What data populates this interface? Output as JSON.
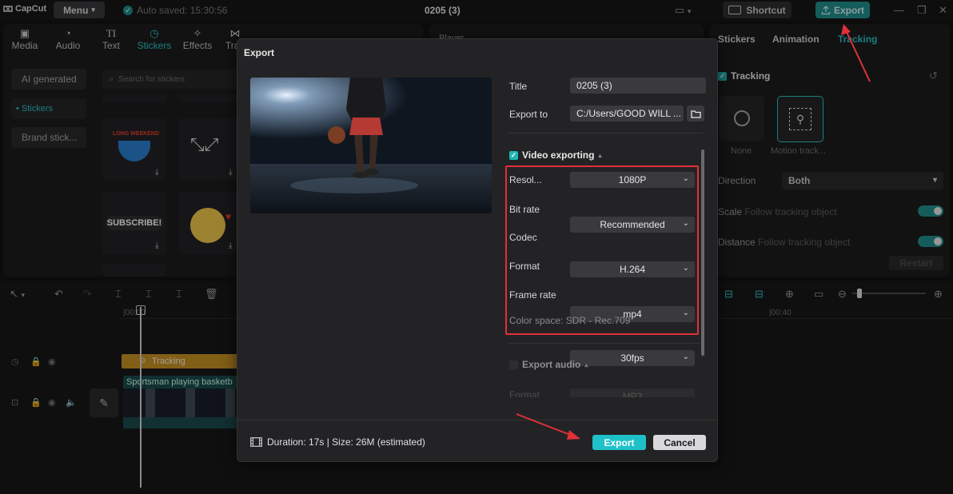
{
  "app": {
    "logo": "CapCut",
    "menu_label": "Menu",
    "autosave": "Auto saved: 15:30:56",
    "project_title": "0205 (3)",
    "shortcut_label": "Shortcut",
    "export_label": "Export"
  },
  "tools": [
    {
      "label": "Media",
      "icon": "media-icon"
    },
    {
      "label": "Audio",
      "icon": "audio-icon"
    },
    {
      "label": "Text",
      "icon": "text-icon"
    },
    {
      "label": "Stickers",
      "icon": "stickers-icon"
    },
    {
      "label": "Effects",
      "icon": "effects-icon"
    },
    {
      "label": "Tran",
      "icon": "transitions-icon"
    }
  ],
  "left_sidebar": {
    "items": [
      "AI generated",
      "• Stickers",
      "Brand stick..."
    ],
    "search_placeholder": "Search for stickers"
  },
  "stickers": {
    "subscribe_text": "SUBSCRIBE!",
    "long_weekend_text": "LONG WEEKEND"
  },
  "player": {
    "label": "Player"
  },
  "right_panel": {
    "tabs": [
      "Stickers",
      "Animation",
      "Tracking"
    ],
    "tracking_header": "Tracking",
    "options": [
      "None",
      "Motion track..."
    ],
    "direction_label": "Direction",
    "direction_value": "Both",
    "scale_label": "Scale",
    "scale_hint": "Follow tracking object",
    "distance_label": "Distance",
    "distance_hint": "Follow tracking object",
    "restart_label": "Restart"
  },
  "timeline": {
    "ticks": [
      "|00:00",
      "|00:40"
    ],
    "tracking_clip": "Tracking",
    "video_clip": "Sportsman playing basketb"
  },
  "dialog": {
    "title": "Export",
    "title_label": "Title",
    "title_value": "0205 (3)",
    "export_to_label": "Export to",
    "export_to_value": "C:/Users/GOOD WILL ...",
    "video_section": "Video exporting",
    "settings": [
      {
        "label": "Resol...",
        "value": "1080P"
      },
      {
        "label": "Bit rate",
        "value": "Recommended"
      },
      {
        "label": "Codec",
        "value": "H.264"
      },
      {
        "label": "Format",
        "value": "mp4"
      },
      {
        "label": "Frame rate",
        "value": "30fps"
      }
    ],
    "color_space": "Color space: SDR - Rec.709",
    "audio_section": "Export audio",
    "audio_format_label": "Format",
    "audio_format_value": "MP3",
    "footer_info": "Duration: 17s | Size: 26M (estimated)",
    "export_button": "Export",
    "cancel_button": "Cancel"
  },
  "colors": {
    "accent": "#1fc1c8",
    "annotation": "#e0303a"
  }
}
